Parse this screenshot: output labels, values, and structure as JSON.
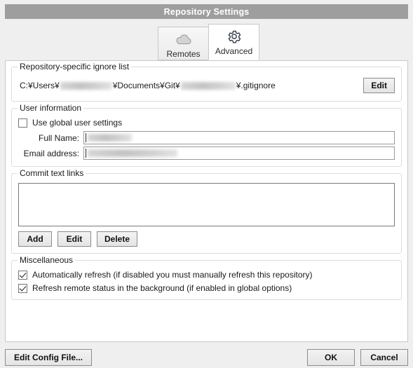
{
  "window": {
    "title": "Repository Settings"
  },
  "tabs": [
    {
      "label": "Remotes",
      "icon": "cloud-icon",
      "selected": false
    },
    {
      "label": "Advanced",
      "icon": "gear-icon",
      "selected": true
    }
  ],
  "ignore_list": {
    "group_title": "Repository-specific ignore list",
    "path_prefix": "C:¥Users¥",
    "path_middle": "¥Documents¥Git¥",
    "path_suffix": "¥.gitignore",
    "edit_button": "Edit"
  },
  "user_information": {
    "group_title": "User information",
    "use_global_label": "Use global user settings",
    "use_global_checked": false,
    "full_name_label": "Full Name:",
    "full_name_value": "",
    "email_label": "Email address:",
    "email_value": ""
  },
  "commit_text_links": {
    "group_title": "Commit text links",
    "items": [],
    "add_button": "Add",
    "edit_button": "Edit",
    "delete_button": "Delete"
  },
  "miscellaneous": {
    "group_title": "Miscellaneous",
    "options": [
      {
        "label": "Automatically refresh (if disabled you must manually refresh this repository)",
        "checked": true
      },
      {
        "label": "Refresh remote status in the background (if enabled in global options)",
        "checked": true
      }
    ]
  },
  "footer": {
    "edit_config_button": "Edit Config File...",
    "ok_button": "OK",
    "cancel_button": "Cancel"
  },
  "colors": {
    "titlebar_bg": "#9e9e9e",
    "titlebar_text": "#ffffff",
    "page_bg": "#efefef",
    "panel_bg": "#ffffff",
    "group_border": "#dcdcdc",
    "button_border": "#8c8c8c"
  }
}
